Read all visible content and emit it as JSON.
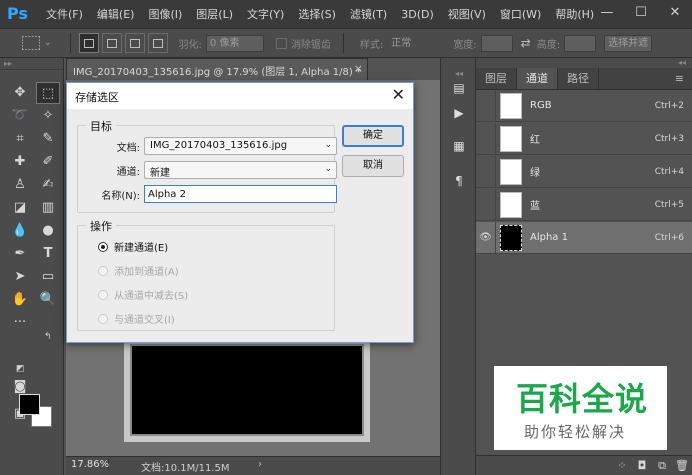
{
  "app": {
    "logo": "Ps"
  },
  "menu": [
    "文件(F)",
    "编辑(E)",
    "图像(I)",
    "图层(L)",
    "文字(Y)",
    "选择(S)",
    "滤镜(T)",
    "3D(D)",
    "视图(V)",
    "窗口(W)",
    "帮助(H)"
  ],
  "window_controls": {
    "minimize": "—",
    "maximize": "☐",
    "close": "✕"
  },
  "options_bar": {
    "feather_label": "羽化:",
    "feather_value": "0 像素",
    "antialias_label": "消除锯齿",
    "style_label": "样式:",
    "style_value": "正常",
    "width_label": "宽度:",
    "height_label": "高度:",
    "select_mask_label": "选择并遮",
    "swap_icon": "swap-arrows-icon"
  },
  "document": {
    "tab_title": "IMG_20170403_135616.jpg @ 17.9% (图层 1, Alpha 1/8) *",
    "close": "×"
  },
  "status": {
    "zoom": "17.86%",
    "doc_info": "文档:10.1M/11.5M",
    "arrow": "›"
  },
  "panel": {
    "tabs": [
      "图层",
      "通道",
      "路径"
    ],
    "active_tab": 1,
    "channels": [
      {
        "name": "RGB",
        "shortcut": "Ctrl+2",
        "thumb": "white",
        "visible": false
      },
      {
        "name": "红",
        "shortcut": "Ctrl+3",
        "thumb": "white",
        "visible": false
      },
      {
        "name": "绿",
        "shortcut": "Ctrl+4",
        "thumb": "white",
        "visible": false
      },
      {
        "name": "蓝",
        "shortcut": "Ctrl+5",
        "thumb": "white",
        "visible": false
      },
      {
        "name": "Alpha 1",
        "shortcut": "Ctrl+6",
        "thumb": "black",
        "visible": true
      }
    ]
  },
  "dialog": {
    "title": "存储选区",
    "close": "✕",
    "target_group": "目标",
    "doc_label": "文档:",
    "doc_value": "IMG_20170403_135616.jpg",
    "channel_label": "通道:",
    "channel_value": "新建",
    "name_label": "名称(N):",
    "name_value": "Alpha 2",
    "operation_group": "操作",
    "operations": [
      {
        "label": "新建通道(E)",
        "checked": true,
        "enabled": true
      },
      {
        "label": "添加到通道(A)",
        "checked": false,
        "enabled": false
      },
      {
        "label": "从通道中减去(S)",
        "checked": false,
        "enabled": false
      },
      {
        "label": "与通道交叉(I)",
        "checked": false,
        "enabled": false
      }
    ],
    "ok_label": "确定",
    "cancel_label": "取消"
  },
  "watermark": {
    "title": "百科全说",
    "subtitle": "助你轻松解决"
  },
  "colors": {
    "accent": "#31a8ff",
    "watermark_green": "#1aa84a",
    "dialog_border": "#7a9bd0"
  }
}
